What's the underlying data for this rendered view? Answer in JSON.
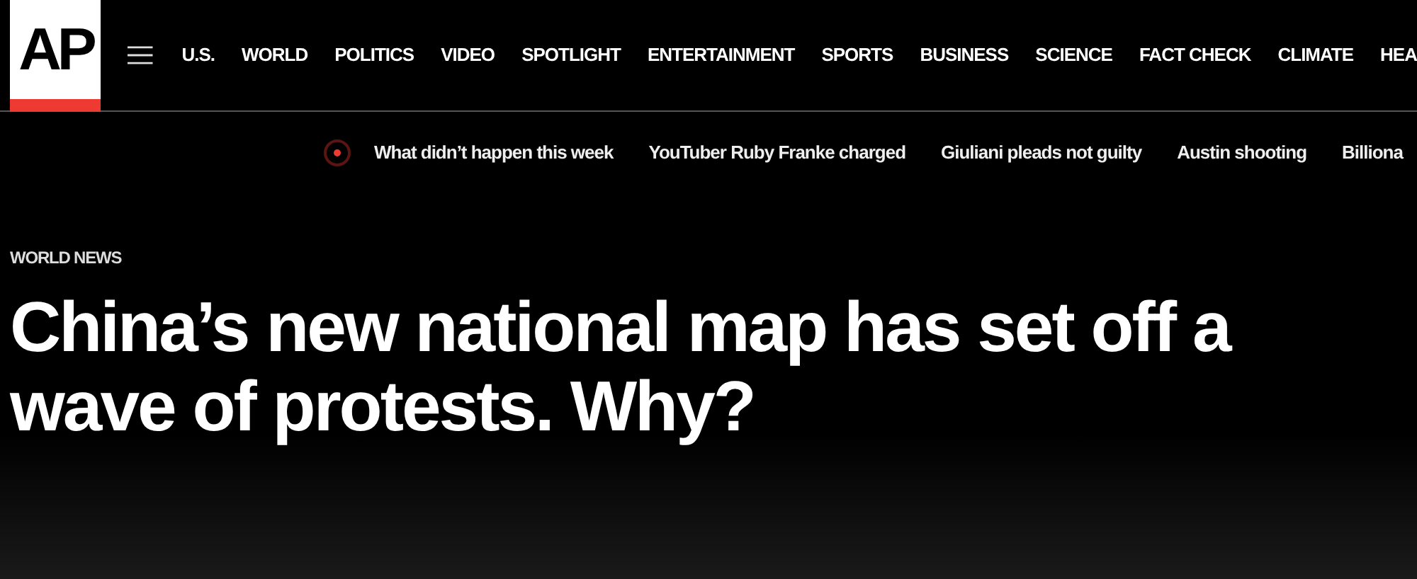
{
  "logo": {
    "text": "AP"
  },
  "nav": [
    {
      "label": "U.S."
    },
    {
      "label": "WORLD"
    },
    {
      "label": "POLITICS"
    },
    {
      "label": "VIDEO"
    },
    {
      "label": "SPOTLIGHT"
    },
    {
      "label": "ENTERTAINMENT"
    },
    {
      "label": "SPORTS"
    },
    {
      "label": "BUSINESS"
    },
    {
      "label": "SCIENCE"
    },
    {
      "label": "FACT CHECK"
    },
    {
      "label": "CLIMATE"
    },
    {
      "label": "HEA"
    }
  ],
  "trending": [
    {
      "label": "What didn’t happen this week"
    },
    {
      "label": "YouTuber Ruby Franke charged"
    },
    {
      "label": "Giuliani pleads not guilty"
    },
    {
      "label": "Austin shooting"
    },
    {
      "label": "Billiona"
    }
  ],
  "article": {
    "section": "WORLD NEWS",
    "headline": "China’s new national map has set off a wave of protests. Why?"
  }
}
